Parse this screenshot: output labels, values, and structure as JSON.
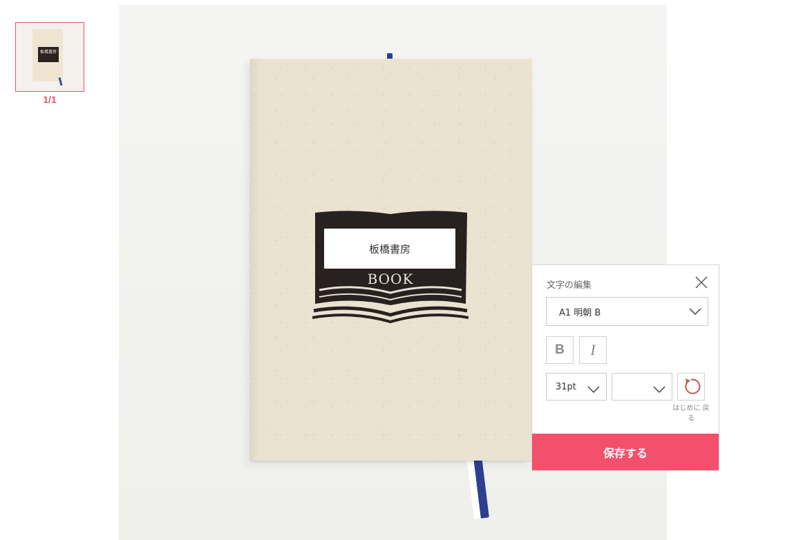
{
  "thumbnail": {
    "logo_text": "板橋書房",
    "page_counter": "1/1"
  },
  "design": {
    "editable_text": "板橋書房",
    "logo_word": "BOOK",
    "cover_color": "#eee6d4",
    "ribbon_color": "#2d3f8f"
  },
  "edit_panel": {
    "title": "文字の編集",
    "font_family_value": "A1 明朝 B",
    "bold_label": "B",
    "italic_label": "I",
    "font_size_value": "31pt",
    "extra_select_value": "",
    "reset_label": "はじめに 戻る",
    "save_label": "保存する",
    "accent_color": "#f2506d"
  }
}
